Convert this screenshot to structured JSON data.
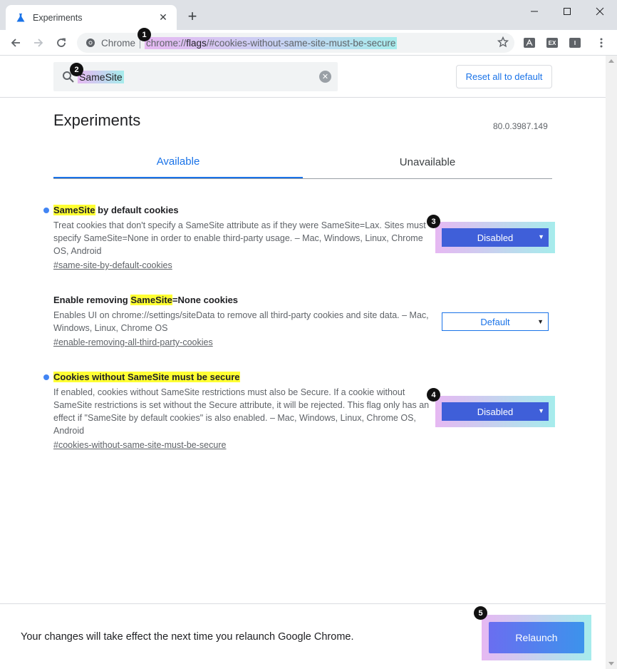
{
  "browser": {
    "tab_title": "Experiments",
    "tab_close": "✕",
    "new_tab": "+",
    "site_label": "Chrome",
    "url_scheme": "chrome://",
    "url_path": "flags",
    "url_hash": "/#cookies-without-same-site-must-be-secure",
    "extensions": [
      "pdf",
      "EX",
      "I"
    ]
  },
  "search": {
    "value": "SameSite",
    "clear": "✕"
  },
  "reset_label": "Reset all to default",
  "page": {
    "title": "Experiments",
    "version": "80.0.3987.149",
    "tabs": [
      "Available",
      "Unavailable"
    ]
  },
  "experiments": [
    {
      "name_highlight": "SameSite",
      "name_rest": " by default cookies",
      "description": "Treat cookies that don't specify a SameSite attribute as if they were SameSite=Lax. Sites must specify SameSite=None in order to enable third-party usage. – Mac, Windows, Linux, Chrome OS, Android",
      "link": "#same-site-by-default-cookies",
      "value": "Disabled",
      "modified": true
    },
    {
      "name_pre": "Enable removing ",
      "name_highlight": "SameSite",
      "name_rest": "=None cookies",
      "description": "Enables UI on chrome://settings/siteData to remove all third-party cookies and site data. – Mac, Windows, Linux, Chrome OS",
      "link": "#enable-removing-all-third-party-cookies",
      "value": "Default",
      "modified": false
    },
    {
      "name_highlight": "Cookies without SameSite must be secure",
      "description": "If enabled, cookies without SameSite restrictions must also be Secure. If a cookie without SameSite restrictions is set without the Secure attribute, it will be rejected. This flag only has an effect if \"SameSite by default cookies\" is also enabled. – Mac, Windows, Linux, Chrome OS, Android",
      "link": "#cookies-without-same-site-must-be-secure",
      "value": "Disabled",
      "modified": true
    }
  ],
  "select_arrow": "▼",
  "relaunch": {
    "message": "Your changes will take effect the next time you relaunch Google Chrome.",
    "button": "Relaunch"
  },
  "markers": [
    "1",
    "2",
    "3",
    "4",
    "5"
  ],
  "colors": {
    "accent": "#1a73e8",
    "modified_dot": "#4285f4",
    "highlight": "#ffff33",
    "select_fill": "#3f5fd9"
  }
}
